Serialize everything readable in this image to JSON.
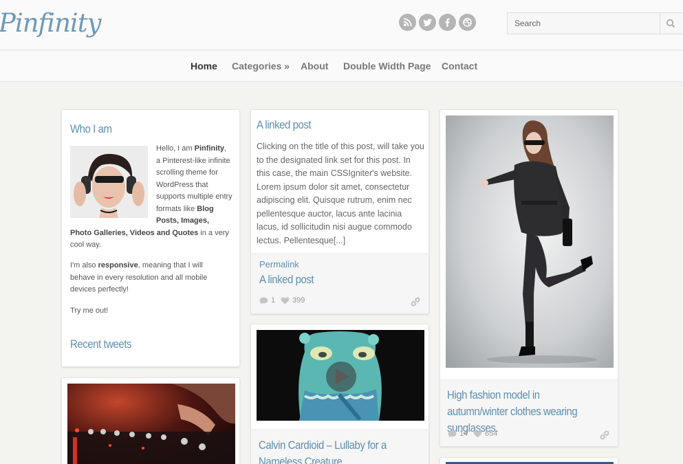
{
  "header": {
    "logo": "Pinfinity",
    "social": [
      "rss-icon",
      "twitter-icon",
      "facebook-icon",
      "dribbble-icon"
    ],
    "search": {
      "placeholder": "Search",
      "value": ""
    }
  },
  "nav": {
    "items": [
      {
        "label": "Home",
        "active": true
      },
      {
        "label": "Categories »",
        "active": false
      },
      {
        "label": "About",
        "active": false
      },
      {
        "label": "Double Width Page",
        "active": false
      },
      {
        "label": "Contact",
        "active": false
      }
    ]
  },
  "about_widget": {
    "title": "Who I am",
    "intro_1": "Hello, I am ",
    "intro_brand": "Pinfinity",
    "intro_2": ", a Pinterest-like infinite scrolling theme for WordPress that supports multiple entry formats like ",
    "intro_formats": "Blog Posts, Images, Photo Galleries, Videos and Quotes",
    "intro_3": " in a very cool way.",
    "resp_1": "I'm also ",
    "resp_bold": "responsive",
    "resp_2": ", meaning that I will behave in every resolution and all mobile devices perfectly!",
    "try": "Try me out!",
    "tweets_title": "Recent tweets"
  },
  "linked_post": {
    "title": "A linked post",
    "excerpt": "Clicking on the title of this post, will take you to the designated link set for this post. In this case, the main CSSIgniter's website. Lorem ipsum dolor sit amet, consectetur adipiscing elit. Quisque rutrum, enim nec pellentesque auctor, lacus ante lacinia lacus, id sollicitudin nisi augue commodo lectus. Pellentesque[...]",
    "permalink": "Permalink",
    "footer_title": "A linked post",
    "comments": "1",
    "likes": "399"
  },
  "video_post": {
    "title": "Calvin Cardioid – Lullaby for a Nameless Creature"
  },
  "fashion_post": {
    "title": "High fashion model in autumn/winter clothes wearing sunglasses.",
    "comments": "14",
    "likes": "654"
  },
  "colors": {
    "accent": "#5f8fae",
    "logo": "#6b9ab8",
    "background": "#f3f3ef"
  }
}
